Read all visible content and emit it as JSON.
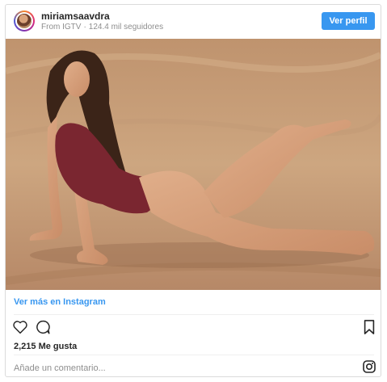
{
  "post": {
    "username": "miriamsaavdra",
    "source": "From IGTV",
    "separator": "·",
    "followers": "124.4 mil seguidores",
    "profile_button": "Ver perfil",
    "more_link": "Ver más en Instagram",
    "likes": "2,215 Me gusta",
    "comment_placeholder": "Añade un comentario..."
  },
  "icons": {
    "avatar": "profile-avatar",
    "like": "heart-icon",
    "comment": "comment-bubble-icon",
    "save": "bookmark-icon",
    "instagram": "instagram-logo-icon"
  },
  "colors": {
    "accent": "#3897f0",
    "text": "#262626",
    "muted": "#8e8e8e"
  }
}
